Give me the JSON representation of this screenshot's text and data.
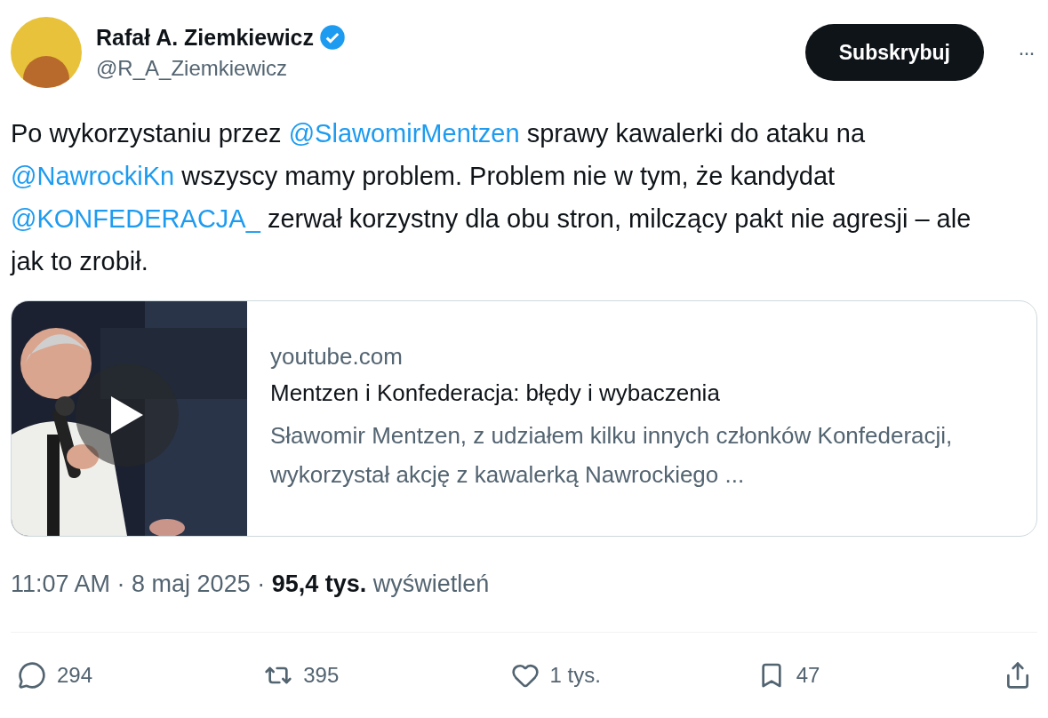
{
  "author": {
    "name": "Rafał A. Ziemkiewicz",
    "verified": true,
    "handle": "@R_A_Ziemkiewicz"
  },
  "subscribe_button": "Subskrybuj",
  "more_button": "···",
  "tweet_text": [
    {
      "kind": "text",
      "text": "Po wykorzystaniu przez "
    },
    {
      "kind": "mention",
      "text": "@SlawomirMentzen"
    },
    {
      "kind": "text",
      "text": " sprawy kawalerki do ataku na "
    },
    {
      "kind": "mention",
      "text": "@NawrockiKn"
    },
    {
      "kind": "text",
      "text": " wszyscy mamy problem. Problem nie w tym, że kandydat "
    },
    {
      "kind": "mention",
      "text": "@KONFEDERACJA_"
    },
    {
      "kind": "text",
      "text": "  zerwał korzystny dla obu stron, milczący pakt nie agresji – ale jak to zrobił."
    }
  ],
  "link_card": {
    "thumbnail": {
      "kind": "picture",
      "has_play_button": true
    },
    "domain": "youtube.com",
    "title": "Mentzen i Konfederacja: błędy i wybaczenia",
    "description": "Sławomir Mentzen, z udziałem kilku innych członków Konfederacji, wykorzystał akcję z kawalerką Nawrockiego ..."
  },
  "meta": "11:07 AM · 8 maj 2025 · **95,4 tys.** wyświetleń",
  "actions": [
    {
      "kind": "reply",
      "count": "294"
    },
    {
      "kind": "repost",
      "count": "395"
    },
    {
      "kind": "like",
      "count": "1 tys."
    },
    {
      "kind": "bookmark",
      "count": "47"
    },
    {
      "kind": "share"
    }
  ]
}
